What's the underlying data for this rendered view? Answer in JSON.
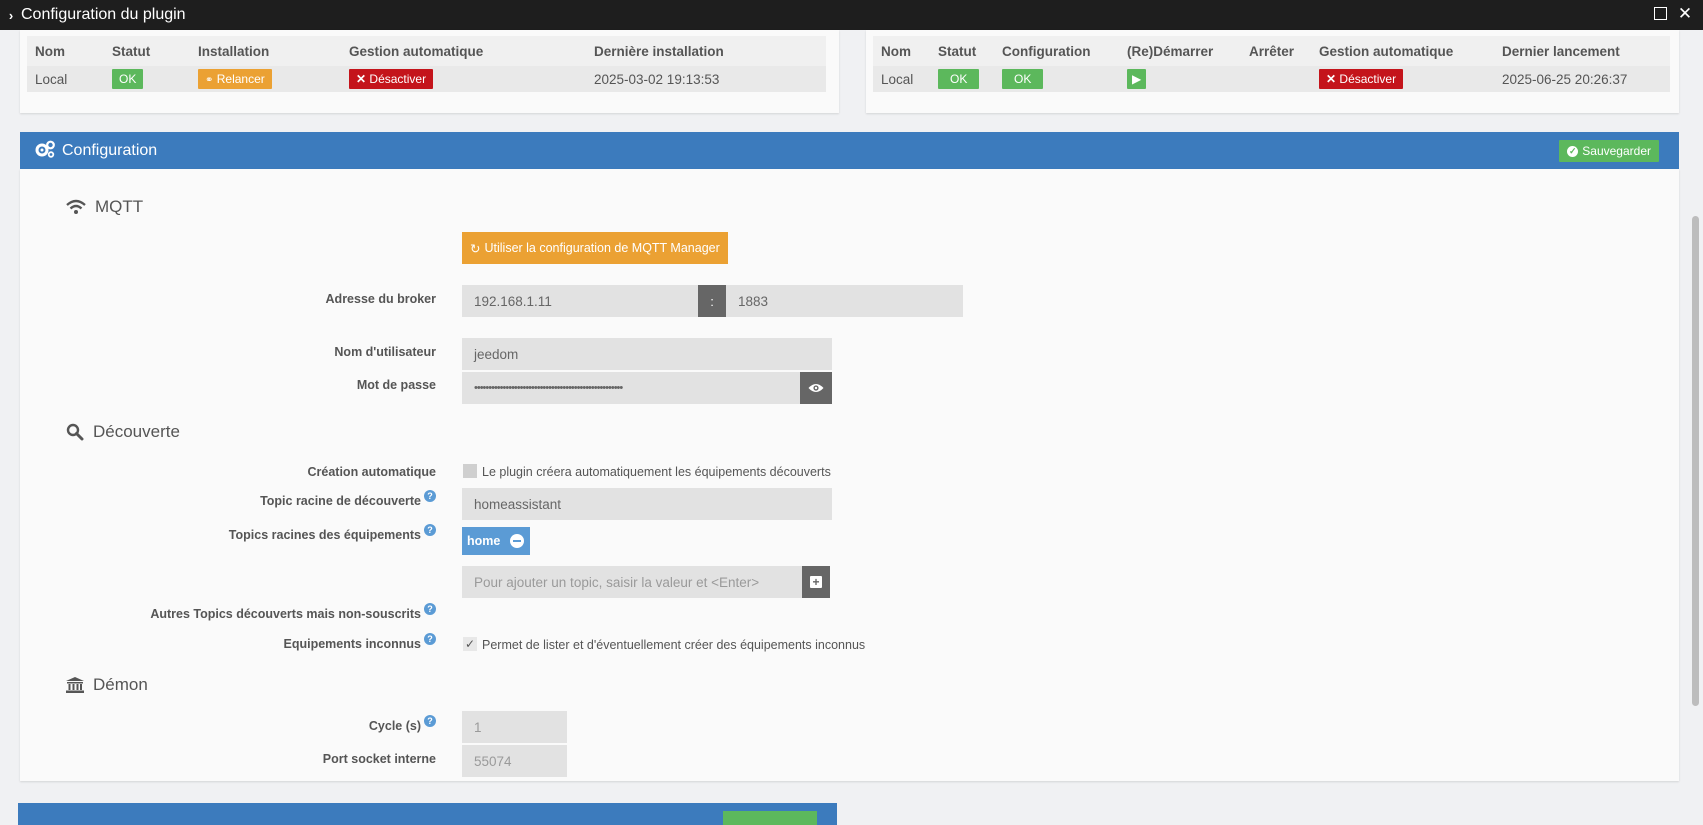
{
  "window": {
    "title": "Configuration du plugin"
  },
  "install_table": {
    "headers": [
      "Nom",
      "Statut",
      "Installation",
      "Gestion automatique",
      "Dernière installation"
    ],
    "row": {
      "nom": "Local",
      "statut": "OK",
      "installation": "Relancer",
      "gestion": "Désactiver",
      "derniere": "2025-03-02 19:13:53"
    }
  },
  "daemon_table": {
    "headers": [
      "Nom",
      "Statut",
      "Configuration",
      "(Re)Démarrer",
      "Arrêter",
      "Gestion automatique",
      "Dernier lancement"
    ],
    "row": {
      "nom": "Local",
      "statut": "OK",
      "configuration": "OK",
      "gestion": "Désactiver",
      "dernier": "2025-06-25 20:26:37"
    }
  },
  "config": {
    "title": "Configuration",
    "save_label": "Sauvegarder",
    "mqtt": {
      "section": "MQTT",
      "use_manager_btn": "Utiliser la configuration de MQTT Manager",
      "broker_label": "Adresse du broker",
      "broker_host": "192.168.1.11",
      "broker_sep": ":",
      "broker_port": "1883",
      "user_label": "Nom d'utilisateur",
      "user_value": "jeedom",
      "pass_label": "Mot de passe",
      "pass_value": "••••••••••••••••••••••••••••••••••••••••••••••••••••"
    },
    "discovery": {
      "section": "Découverte",
      "auto_label": "Création automatique",
      "auto_text": "Le plugin créera automatiquement les équipements découverts",
      "root_label": "Topic racine de découverte",
      "root_value": "homeassistant",
      "roots_label": "Topics racines des équipements",
      "roots_tag": "home",
      "roots_placeholder": "Pour ajouter un topic, saisir la valeur et <Enter>",
      "others_label": "Autres Topics découverts mais non-souscrits",
      "unknown_label": "Equipements inconnus",
      "unknown_text": "Permet de lister et d'éventuellement créer des équipements inconnus"
    },
    "daemon": {
      "section": "Démon",
      "cycle_label": "Cycle (s)",
      "cycle_value": "1",
      "port_label": "Port socket interne",
      "port_value": "55074"
    }
  },
  "colors": {
    "header_blue": "#3c7bbd",
    "ok_green": "#5cb85c",
    "warn_orange": "#eba133",
    "danger_red": "#c4141b",
    "tag_blue": "#5b9bd5"
  },
  "icons": [
    "chevron-right-icon",
    "maximize-icon",
    "close-icon",
    "cogs-icon",
    "check-circle-icon",
    "wifi-icon",
    "refresh-icon",
    "eye-icon",
    "search-icon",
    "plus-square-icon",
    "bank-icon",
    "bicycle-icon",
    "times-icon",
    "play-icon",
    "question-icon",
    "minus-circle-icon"
  ]
}
